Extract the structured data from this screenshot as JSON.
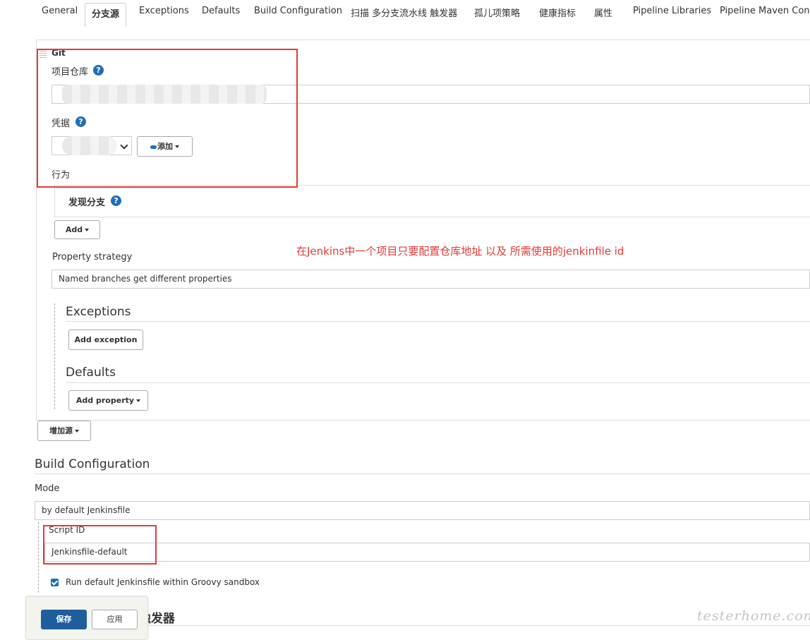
{
  "tabs": [
    {
      "label": "General"
    },
    {
      "label": "分支源"
    },
    {
      "label": "Exceptions"
    },
    {
      "label": "Defaults"
    },
    {
      "label": "Build Configuration"
    },
    {
      "label": "扫描 多分支流水线 触发器"
    },
    {
      "label": "孤儿项策略"
    },
    {
      "label": "健康指标"
    },
    {
      "label": "属性"
    },
    {
      "label": "Pipeline Libraries"
    },
    {
      "label": "Pipeline Maven Configu"
    }
  ],
  "active_tab": "分支源",
  "git": {
    "title": "Git",
    "repo_label": "项目仓库",
    "credentials_label": "凭据",
    "add_button": "添加",
    "behaviors_label": "行为",
    "discover_branches": "发现分支",
    "add_behavior": "Add"
  },
  "property_strategy": {
    "label": "Property strategy",
    "value": "Named branches get different properties"
  },
  "exceptions": {
    "title": "Exceptions",
    "add_button": "Add exception"
  },
  "defaults": {
    "title": "Defaults",
    "add_button": "Add property"
  },
  "add_source_button": "增加源",
  "annotation": "在Jenkins中一个项目只要配置仓库地址 以及 所需使用的jenkinfile id",
  "build_config": {
    "title": "Build Configuration",
    "mode_label": "Mode",
    "mode_value": "by default Jenkinsfile",
    "script_id_label": "Script ID",
    "script_id_value": "Jenkinsfile-default",
    "sandbox_label": "Run default Jenkinsfile within Groovy sandbox",
    "sandbox_checked": true
  },
  "next_section_title": "扫描 多分支流水线 触发器",
  "footer": {
    "save": "保存",
    "apply": "应用"
  },
  "watermark": "testerhome.com",
  "colors": {
    "accent": "#1f6fb5",
    "save_button": "#1f5e9c",
    "annotation_red": "#e53935"
  }
}
